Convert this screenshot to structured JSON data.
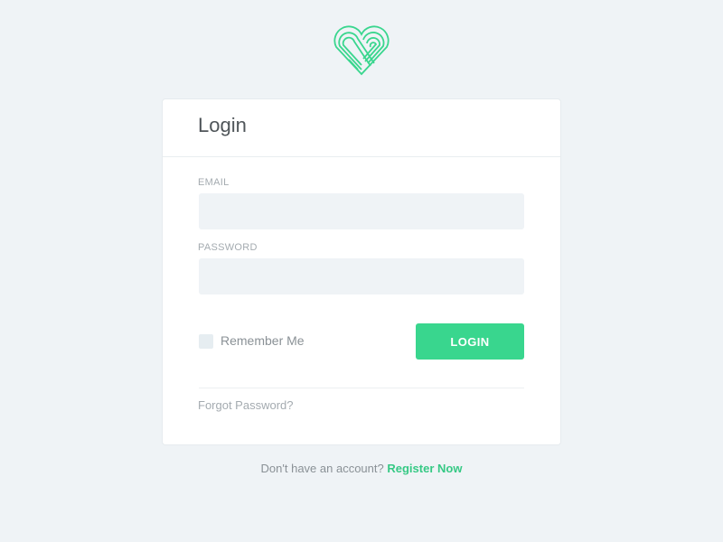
{
  "brand": {
    "logo_icon": "heart-stripes-logo",
    "accent_color": "#39d68e"
  },
  "login_card": {
    "title": "Login",
    "email": {
      "label": "EMAIL",
      "value": "",
      "placeholder": ""
    },
    "password": {
      "label": "PASSWORD",
      "value": "",
      "placeholder": ""
    },
    "remember_me": {
      "label": "Remember Me",
      "checked": false
    },
    "login_button_label": "LOGIN",
    "forgot_password_label": "Forgot Password?"
  },
  "footer": {
    "prompt_text": "Don't have an account?",
    "register_label": "Register Now"
  }
}
